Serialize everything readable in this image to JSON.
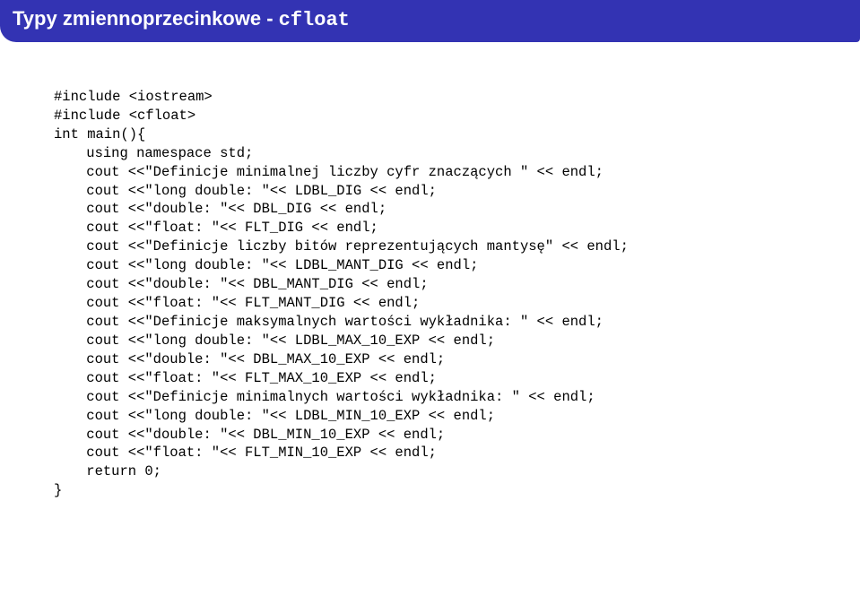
{
  "header": {
    "title_prefix": "Typy zmiennoprzecinkowe - ",
    "title_code": "cfloat"
  },
  "code": {
    "lines": [
      "#include <iostream>",
      "#include <cfloat>",
      "int main(){",
      "using namespace std;",
      "cout <<\"Definicje minimalnej liczby cyfr znaczących \" << endl;",
      "cout <<\"long double: \"<< LDBL_DIG << endl;",
      "cout <<\"double: \"<< DBL_DIG << endl;",
      "cout <<\"float: \"<< FLT_DIG << endl;",
      "cout <<\"Definicje liczby bitów reprezentujących mantysę\" << endl;",
      "cout <<\"long double: \"<< LDBL_MANT_DIG << endl;",
      "cout <<\"double: \"<< DBL_MANT_DIG << endl;",
      "cout <<\"float: \"<< FLT_MANT_DIG << endl;",
      "cout <<\"Definicje maksymalnych wartości wykładnika: \" << endl;",
      "cout <<\"long double: \"<< LDBL_MAX_10_EXP << endl;",
      "cout <<\"double: \"<< DBL_MAX_10_EXP << endl;",
      "cout <<\"float: \"<< FLT_MAX_10_EXP << endl;",
      "cout <<\"Definicje minimalnych wartości wykładnika: \" << endl;",
      "cout <<\"long double: \"<< LDBL_MIN_10_EXP << endl;",
      "cout <<\"double: \"<< DBL_MIN_10_EXP << endl;",
      "cout <<\"float: \"<< FLT_MIN_10_EXP << endl;",
      "return 0;",
      "}"
    ]
  }
}
